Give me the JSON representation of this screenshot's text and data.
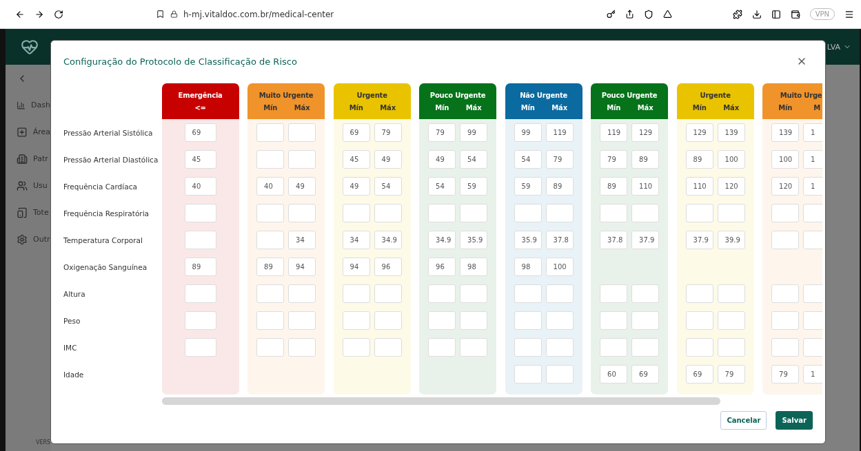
{
  "browser": {
    "url": "h-mj.vitaldoc.com.br/medical-center",
    "vpn_label": "VPN"
  },
  "app_header": {
    "user_label": "LVA"
  },
  "sidebar": {
    "items": [
      {
        "kind": "chart",
        "label": "Dash"
      },
      {
        "kind": "plus",
        "label": "Área"
      },
      {
        "kind": "building",
        "label": "Patr"
      },
      {
        "kind": "users",
        "label": "Usu"
      },
      {
        "kind": "tablet",
        "label": "Tote"
      },
      {
        "kind": "gear",
        "label": "Outr"
      }
    ],
    "version": "VERS"
  },
  "modal": {
    "title": "Configuração do Protocolo de Classificação de Risco",
    "row_labels": [
      "Pressão Arterial Sistólica",
      "Pressão Arterial Diastólica",
      "Frequência Cardíaca",
      "Frequência Respiratória",
      "Temperatura Corporal",
      "Oxigenação Sanguínea",
      "Altura",
      "Peso",
      "IMC",
      "Idade"
    ],
    "columns": [
      {
        "title": "Emergência",
        "color": "#c70000",
        "subheaders": [
          "<="
        ],
        "cells": [
          [
            "69"
          ],
          [
            "45"
          ],
          [
            "40"
          ],
          [
            null
          ],
          [
            null
          ],
          [
            "89"
          ],
          [
            null
          ],
          [
            null
          ],
          [
            null
          ],
          null
        ]
      },
      {
        "title": "Muito Urgente",
        "color": "#f0932b",
        "subheaders": [
          "Mín",
          "Máx"
        ],
        "cells": [
          [
            null,
            null
          ],
          [
            null,
            null
          ],
          [
            "40",
            "49"
          ],
          [
            null,
            null
          ],
          [
            null,
            "34"
          ],
          [
            "89",
            "94"
          ],
          [
            null,
            null
          ],
          [
            null,
            null
          ],
          [
            null,
            null
          ],
          null
        ]
      },
      {
        "title": "Urgente",
        "color": "#e9c300",
        "subheaders": [
          "Mín",
          "Máx"
        ],
        "cells": [
          [
            "69",
            "79"
          ],
          [
            "45",
            "49"
          ],
          [
            "49",
            "54"
          ],
          [
            null,
            null
          ],
          [
            "34",
            "34.9"
          ],
          [
            "94",
            "96"
          ],
          [
            null,
            null
          ],
          [
            null,
            null
          ],
          [
            null,
            null
          ],
          null
        ]
      },
      {
        "title": "Pouco Urgente",
        "color": "#06721a",
        "subheaders": [
          "Mín",
          "Máx"
        ],
        "cells": [
          [
            "79",
            "99"
          ],
          [
            "49",
            "54"
          ],
          [
            "54",
            "59"
          ],
          [
            null,
            null
          ],
          [
            "34.9",
            "35.9"
          ],
          [
            "96",
            "98"
          ],
          [
            null,
            null
          ],
          [
            null,
            null
          ],
          [
            null,
            null
          ],
          null
        ]
      },
      {
        "title": "Não Urgente",
        "color": "#0b6a9f",
        "subheaders": [
          "Mín",
          "Máx"
        ],
        "cells": [
          [
            "99",
            "119"
          ],
          [
            "54",
            "79"
          ],
          [
            "59",
            "89"
          ],
          [
            null,
            null
          ],
          [
            "35.9",
            "37.8"
          ],
          [
            "98",
            "100"
          ],
          [
            null,
            null
          ],
          [
            null,
            null
          ],
          [
            null,
            null
          ],
          [
            null,
            null
          ]
        ]
      },
      {
        "title": "Pouco Urgente",
        "color": "#06721a",
        "subheaders": [
          "Mín",
          "Máx"
        ],
        "cells": [
          [
            "119",
            "129"
          ],
          [
            "79",
            "89"
          ],
          [
            "89",
            "110"
          ],
          [
            null,
            null
          ],
          [
            "37.8",
            "37.9"
          ],
          null,
          [
            null,
            null
          ],
          [
            null,
            null
          ],
          [
            null,
            null
          ],
          [
            "60",
            "69"
          ]
        ]
      },
      {
        "title": "Urgente",
        "color": "#e9c300",
        "subheaders": [
          "Mín",
          "Máx"
        ],
        "cells": [
          [
            "129",
            "139"
          ],
          [
            "89",
            "100"
          ],
          [
            "110",
            "120"
          ],
          [
            null,
            null
          ],
          [
            "37.9",
            "39.9"
          ],
          null,
          [
            null,
            null
          ],
          [
            null,
            null
          ],
          [
            null,
            null
          ],
          [
            "69",
            "79"
          ]
        ]
      },
      {
        "title": "Muito Urge",
        "color": "#f0932b",
        "subheaders": [
          "Mín",
          "M"
        ],
        "cells": [
          [
            "139",
            "1"
          ],
          [
            "100",
            "1"
          ],
          [
            "120",
            "1"
          ],
          [
            null,
            null
          ],
          [
            null,
            null
          ],
          null,
          [
            null,
            null
          ],
          [
            null,
            null
          ],
          [
            null,
            null
          ],
          [
            "79",
            "1"
          ]
        ]
      }
    ],
    "buttons": [
      {
        "kind": "secondary",
        "label": "Cancelar"
      },
      {
        "kind": "primary",
        "label": "Salvar"
      }
    ]
  }
}
